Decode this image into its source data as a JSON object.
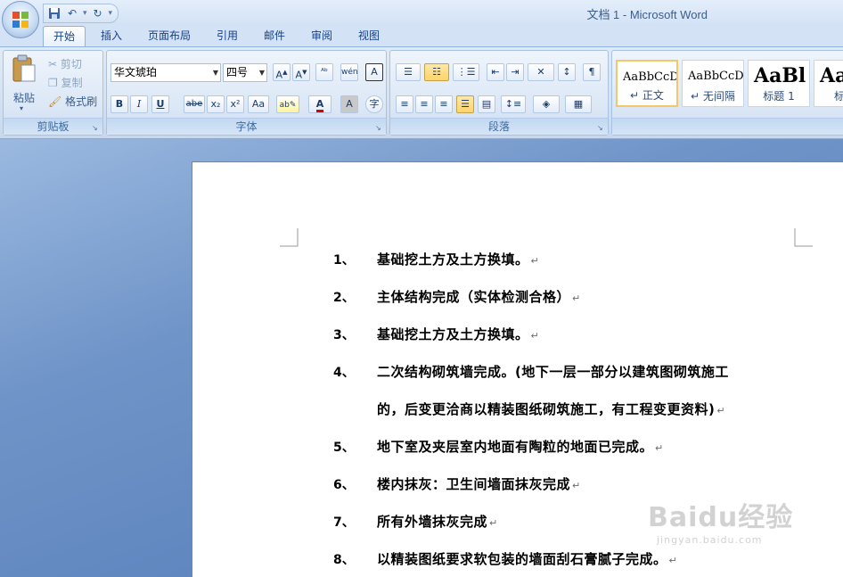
{
  "window": {
    "title": "文档 1 - Microsoft Word"
  },
  "quick_access": {
    "icons": [
      "save-icon",
      "undo-icon",
      "redo-icon",
      "customize-icon"
    ]
  },
  "tabs": [
    {
      "label": "开始",
      "active": true
    },
    {
      "label": "插入"
    },
    {
      "label": "页面布局"
    },
    {
      "label": "引用"
    },
    {
      "label": "邮件"
    },
    {
      "label": "审阅"
    },
    {
      "label": "视图"
    }
  ],
  "clipboard": {
    "label": "剪贴板",
    "paste": "粘贴",
    "cut": "剪切",
    "copy": "复制",
    "format_painter": "格式刷"
  },
  "font": {
    "label": "字体",
    "family": "华文琥珀",
    "size": "四号",
    "buttons": [
      "B",
      "I",
      "U",
      "abe",
      "x₂",
      "x²",
      "Aa",
      "A",
      "A"
    ]
  },
  "paragraph": {
    "label": "段落"
  },
  "styles": {
    "items": [
      {
        "sample": "AaBbCcDd",
        "name": "正文",
        "selected": true
      },
      {
        "sample": "AaBbCcDd",
        "name": "无间隔"
      },
      {
        "sample": "AaBl",
        "name": "标题 1"
      },
      {
        "sample": "AaE",
        "name": "标题"
      }
    ]
  },
  "document": {
    "items": [
      {
        "num": "1、",
        "lines": [
          "基础挖土方及土方换填。"
        ]
      },
      {
        "num": "2、",
        "lines": [
          "主体结构完成（实体检测合格）"
        ]
      },
      {
        "num": "3、",
        "lines": [
          "基础挖土方及土方换填。"
        ]
      },
      {
        "num": "4、",
        "lines": [
          "二次结构砌筑墙完成。(地下一层一部分以建筑图砌筑施工",
          "的，后变更洽商以精装图纸砌筑施工，有工程变更资料)"
        ]
      },
      {
        "num": "5、",
        "lines": [
          "地下室及夹层室内地面有陶粒的地面已完成。"
        ]
      },
      {
        "num": "6、",
        "lines": [
          "楼内抹灰：卫生间墙面抹灰完成"
        ]
      },
      {
        "num": "7、",
        "lines": [
          "所有外墙抹灰完成"
        ]
      },
      {
        "num": "8、",
        "lines": [
          "以精装图纸要求软包装的墙面刮石膏腻子完成。"
        ]
      }
    ],
    "paragraph_mark": "↵"
  },
  "watermark": {
    "brand": "Baidu经验",
    "url": "jingyan.baidu.com"
  }
}
